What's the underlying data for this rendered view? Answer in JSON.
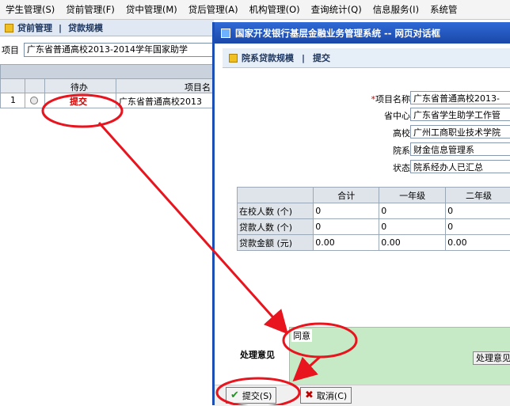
{
  "menu": {
    "items": [
      "学生管理(S)",
      "贷前管理(F)",
      "贷中管理(M)",
      "贷后管理(A)",
      "机构管理(O)",
      "查询统计(Q)",
      "信息服务(I)",
      "系统管"
    ]
  },
  "background_page": {
    "toolbar": {
      "left_title": "贷前管理",
      "separator": "|",
      "right_title": "贷款规模"
    },
    "filter": {
      "label": "项目",
      "value": "广东省普通高校2013-2014学年国家助学"
    },
    "table": {
      "header_todo": "待办",
      "header_project": "项目名",
      "rows": [
        {
          "index": "1",
          "todo": "提交",
          "project": "广东省普通高校2013"
        }
      ]
    }
  },
  "dialog": {
    "title": "国家开发银行基层金融业务管理系统 -- 网页对话框",
    "header": {
      "left_title": "院系贷款规模",
      "separator": "|",
      "right_title": "提交"
    },
    "fields": [
      {
        "label": "项目名称",
        "required_mark": "*",
        "value": "广东省普通高校2013-"
      },
      {
        "label": "省中心",
        "required_mark": "",
        "value": "广东省学生助学工作管"
      },
      {
        "label": "高校",
        "required_mark": "",
        "value": "广州工商职业技术学院"
      },
      {
        "label": "院系",
        "required_mark": "",
        "value": "财金信息管理系"
      },
      {
        "label": "状态",
        "required_mark": "",
        "value": "院系经办人已汇总"
      }
    ],
    "stats_table": {
      "columns": [
        "",
        "合计",
        "一年级",
        "二年级"
      ],
      "rows": [
        {
          "label": "在校人数 (个)",
          "values": [
            "0",
            "0",
            "0"
          ]
        },
        {
          "label": "贷款人数 (个)",
          "values": [
            "0",
            "0",
            "0"
          ]
        },
        {
          "label": "贷款金额 (元)",
          "values": [
            "0.00",
            "0.00",
            "0.00"
          ]
        }
      ]
    },
    "opinion": {
      "label": "处理意见",
      "value": "同意",
      "button_label": "处理意见"
    },
    "buttons": {
      "submit": "提交(S)",
      "cancel": "取消(C)"
    }
  },
  "annotations": {
    "color": "#e8141e"
  }
}
